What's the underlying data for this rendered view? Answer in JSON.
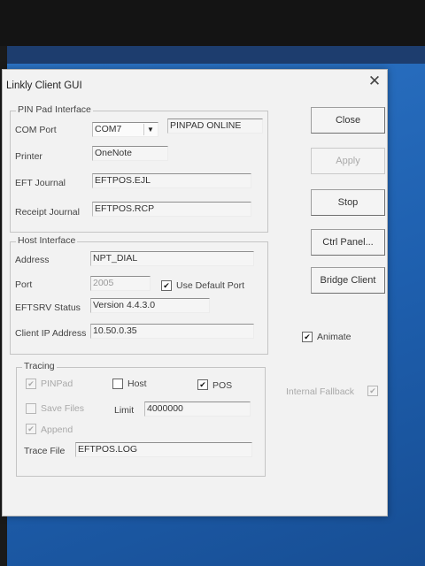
{
  "window": {
    "title": "Linkly Client GUI",
    "close_glyph": "✕"
  },
  "pinpad": {
    "legend": "PIN Pad Interface",
    "com_port_label": "COM Port",
    "com_port_value": "COM7",
    "status": "PINPAD ONLINE",
    "printer_label": "Printer",
    "printer_value": "OneNote",
    "eft_journal_label": "EFT Journal",
    "eft_journal_value": "EFTPOS.EJL",
    "receipt_journal_label": "Receipt Journal",
    "receipt_journal_value": "EFTPOS.RCP"
  },
  "host": {
    "legend": "Host Interface",
    "address_label": "Address",
    "address_value": "NPT_DIAL",
    "port_label": "Port",
    "port_value": "2005",
    "use_default_port_label": "Use Default Port",
    "use_default_port_checked": true,
    "eftsrv_status_label": "EFTSRV Status",
    "eftsrv_status_value": "Version 4.4.3.0",
    "client_ip_label": "Client IP Address",
    "client_ip_value": "10.50.0.35"
  },
  "tracing": {
    "legend": "Tracing",
    "pinpad_label": "PINPad",
    "pinpad_checked": true,
    "host_label": "Host",
    "host_checked": false,
    "pos_label": "POS",
    "pos_checked": true,
    "save_files_label": "Save Files",
    "save_files_checked": false,
    "limit_label": "Limit",
    "limit_value": "4000000",
    "append_label": "Append",
    "append_checked": true,
    "trace_file_label": "Trace File",
    "trace_file_value": "EFTPOS.LOG"
  },
  "buttons": {
    "close": "Close",
    "apply": "Apply",
    "stop": "Stop",
    "ctrl_panel": "Ctrl Panel...",
    "bridge_client": "Bridge Client"
  },
  "options": {
    "animate_label": "Animate",
    "animate_checked": true,
    "internal_fallback_label": "Internal Fallback",
    "internal_fallback_checked": true
  },
  "check_glyph": "✔"
}
